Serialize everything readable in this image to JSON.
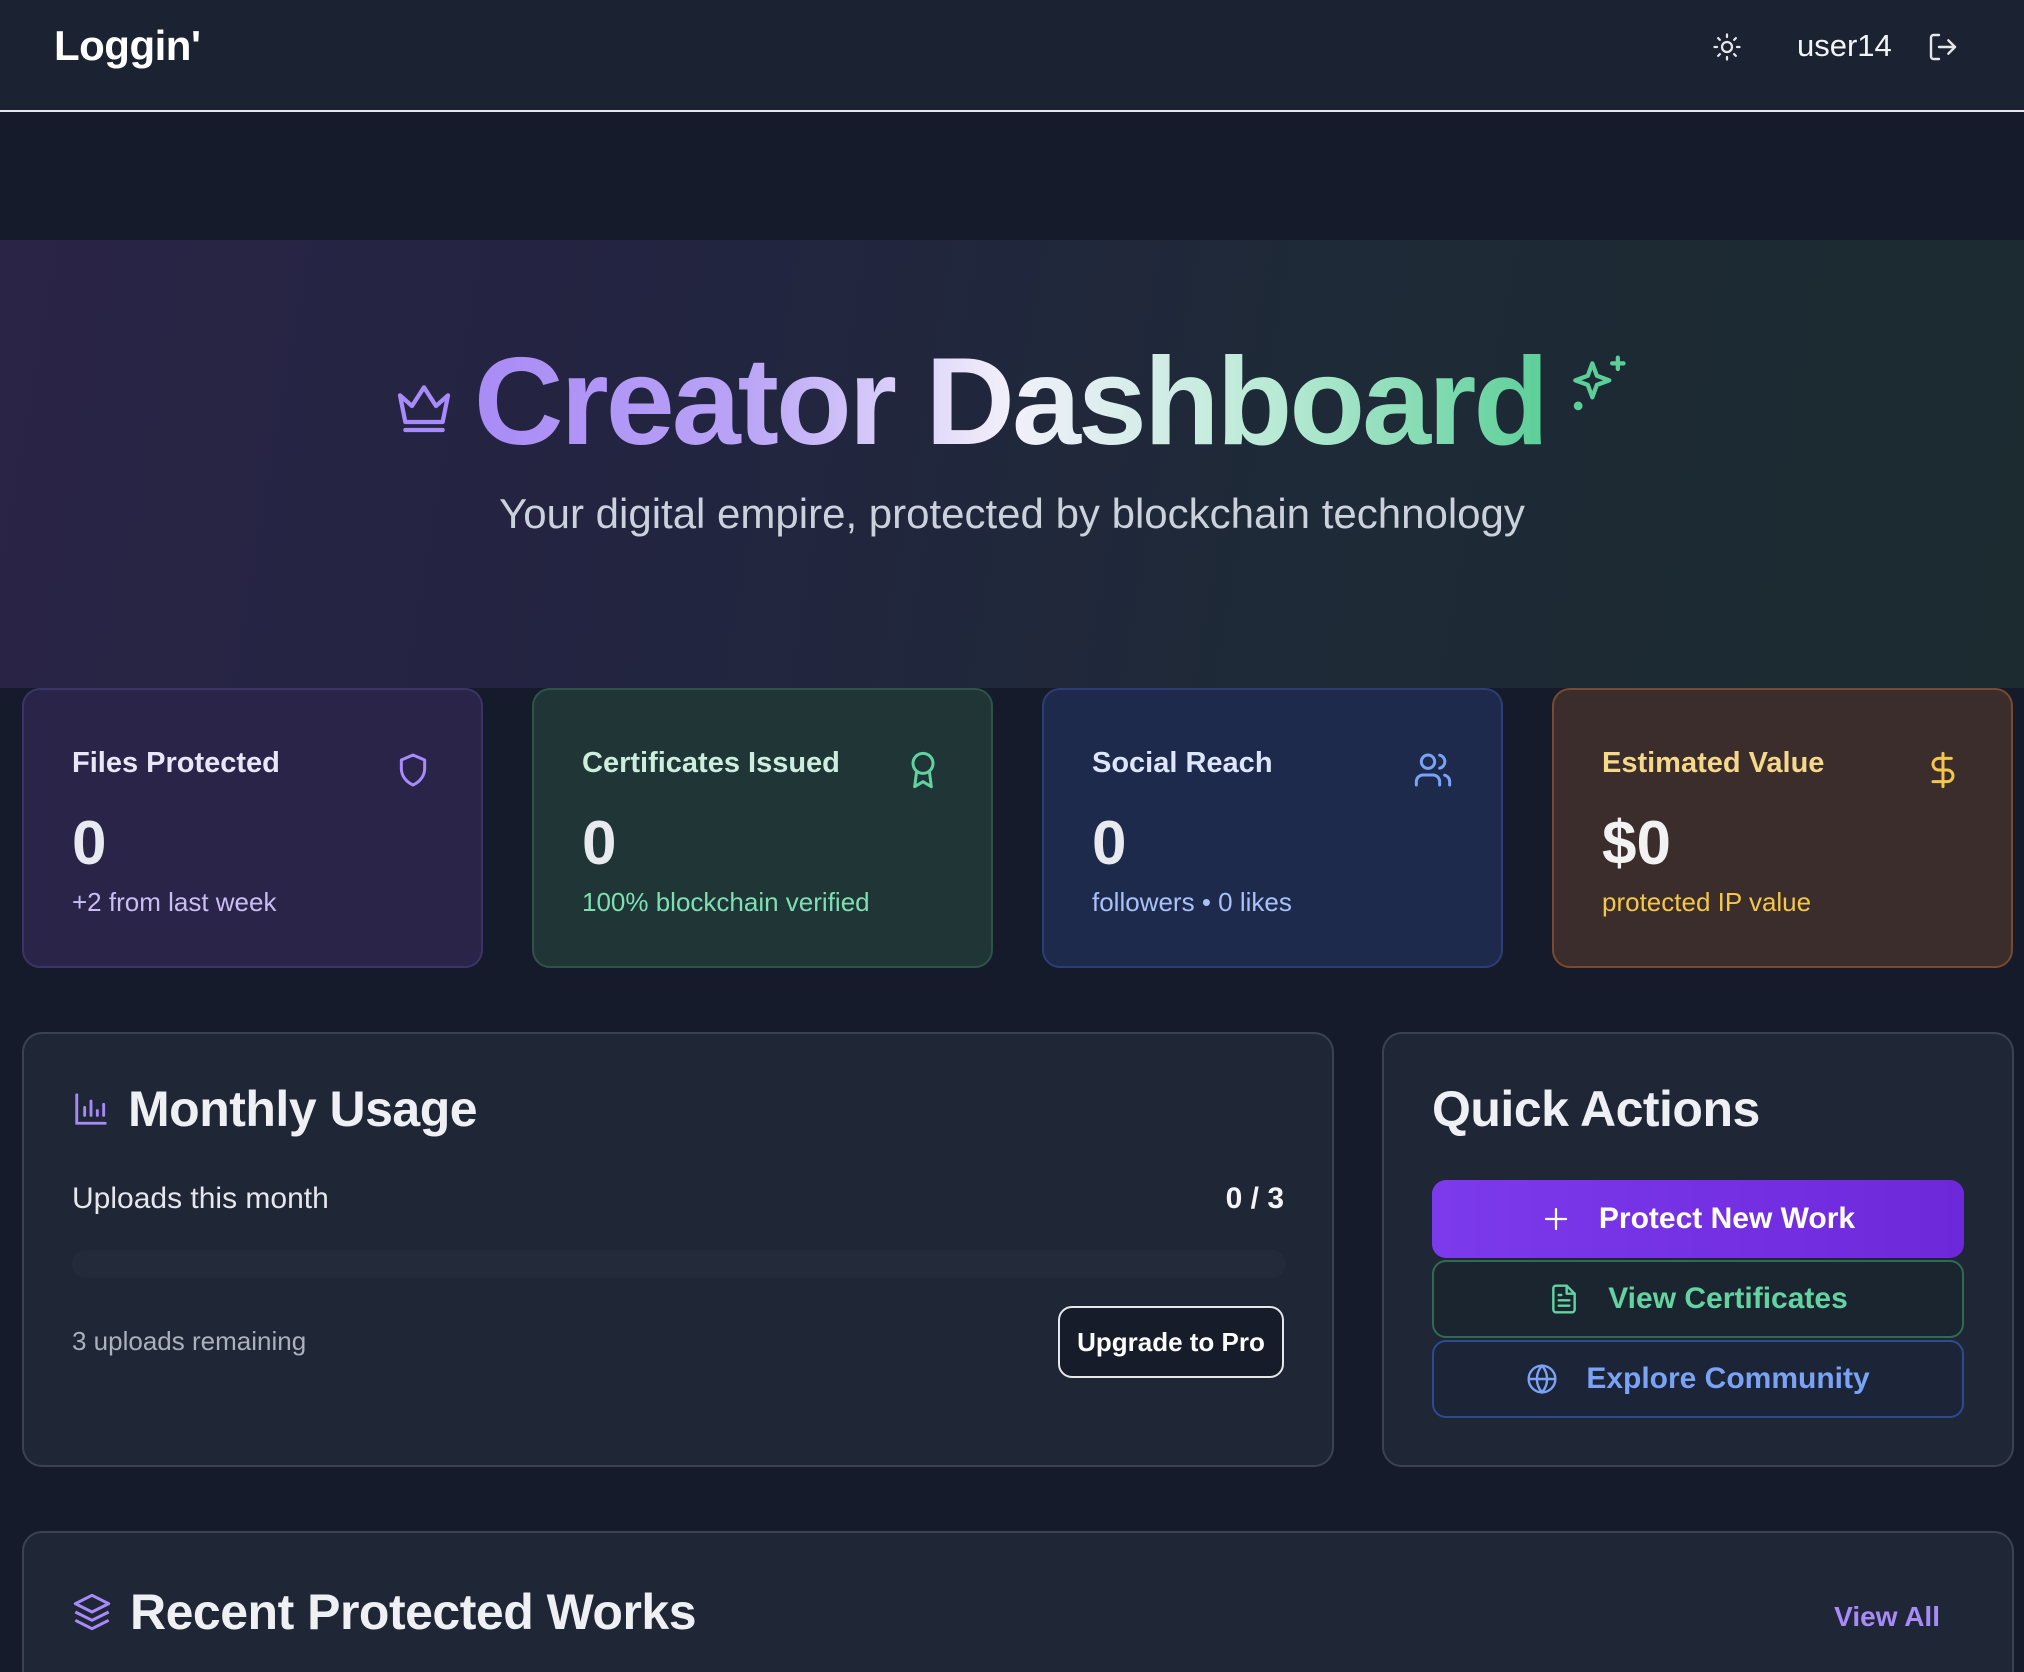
{
  "header": {
    "brand": "Loggin'",
    "username": "user14",
    "icons": {
      "theme": "sun-icon",
      "logout": "logout-icon"
    }
  },
  "hero": {
    "title": "Creator Dashboard",
    "subtitle": "Your digital empire, protected by blockchain technology",
    "icons": {
      "left": "crown-icon",
      "right": "sparkles-icon"
    },
    "colors": {
      "gradient_start": "#a98bf5",
      "gradient_mid": "#f2f0fb",
      "gradient_end": "#5ccf98"
    }
  },
  "stats": [
    {
      "label": "Files Protected",
      "value": "0",
      "note": "+2 from last week",
      "icon": "shield-icon",
      "accent": "#a78bfa"
    },
    {
      "label": "Certificates Issued",
      "value": "0",
      "note": "100% blockchain verified",
      "icon": "award-icon",
      "accent": "#5fd3a0"
    },
    {
      "label": "Social Reach",
      "value": "0",
      "note": "followers • 0 likes",
      "icon": "users-icon",
      "accent": "#7aa2f5"
    },
    {
      "label": "Estimated Value",
      "value": "$0",
      "note": "protected IP value",
      "icon": "dollar-icon",
      "accent": "#f4c74b"
    }
  ],
  "usage": {
    "title": "Monthly Usage",
    "icon": "bar-chart-icon",
    "uploads_label": "Uploads this month",
    "uploads_count": "0 / 3",
    "progress_fraction": 0,
    "remaining": "3 uploads remaining",
    "upgrade_label": "Upgrade to Pro"
  },
  "actions": {
    "title": "Quick Actions",
    "protect_label": "Protect New Work",
    "certificates_label": "View Certificates",
    "community_label": "Explore Community",
    "icons": {
      "protect": "plus-icon",
      "certificates": "file-text-icon",
      "community": "globe-icon"
    }
  },
  "recent": {
    "title": "Recent Protected Works",
    "icon": "layers-icon",
    "view_all": "View All"
  }
}
